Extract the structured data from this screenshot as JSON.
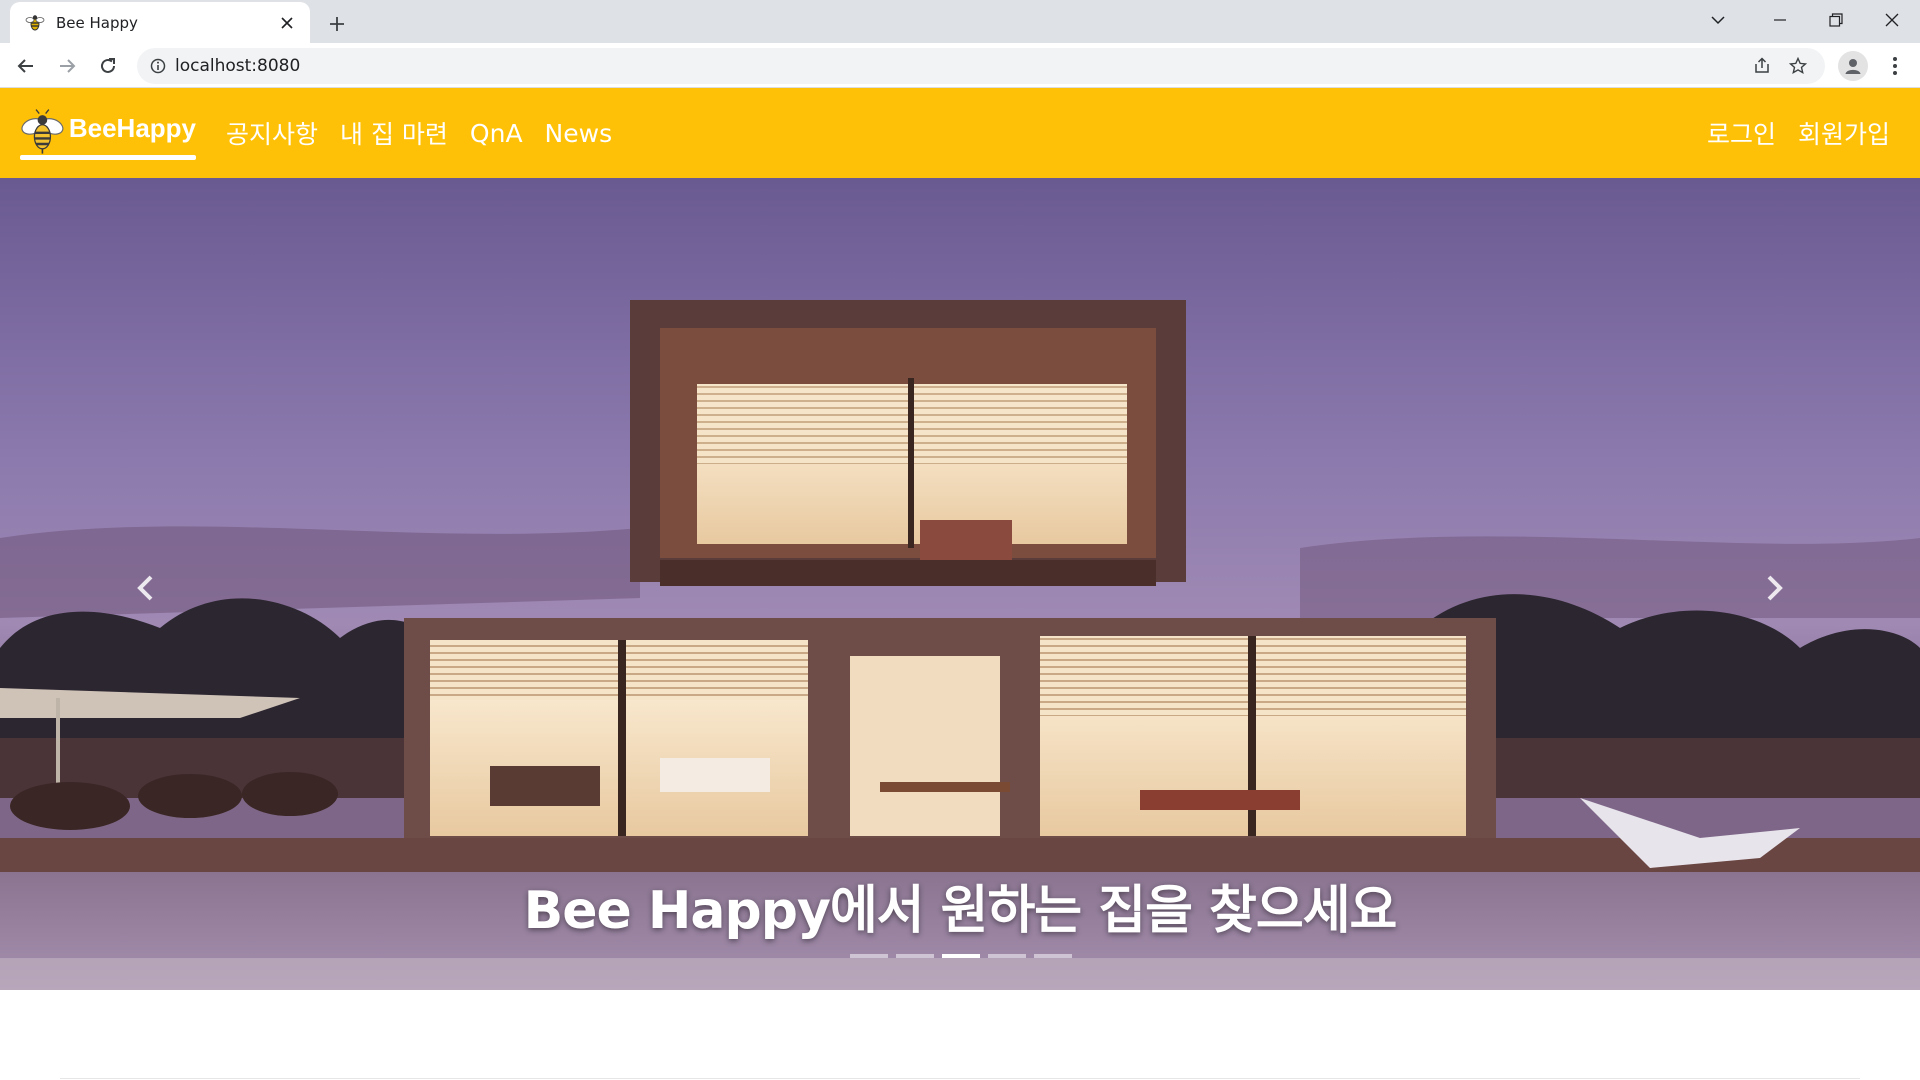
{
  "browser": {
    "tab_title": "Bee Happy",
    "url": "localhost:8080",
    "tab_close_icon": "close-icon",
    "new_tab_icon": "plus-icon"
  },
  "site": {
    "brand": "BeeHappy",
    "brand_color": "#ffc107",
    "nav_links": [
      "공지사항",
      "내 집 마련",
      "QnA",
      "News"
    ],
    "auth_links": [
      "로그인",
      "회원가입"
    ]
  },
  "hero": {
    "caption": "Bee Happy에서 원하는 집을 찾으세요",
    "slide_count": 5,
    "active_slide": 3
  }
}
